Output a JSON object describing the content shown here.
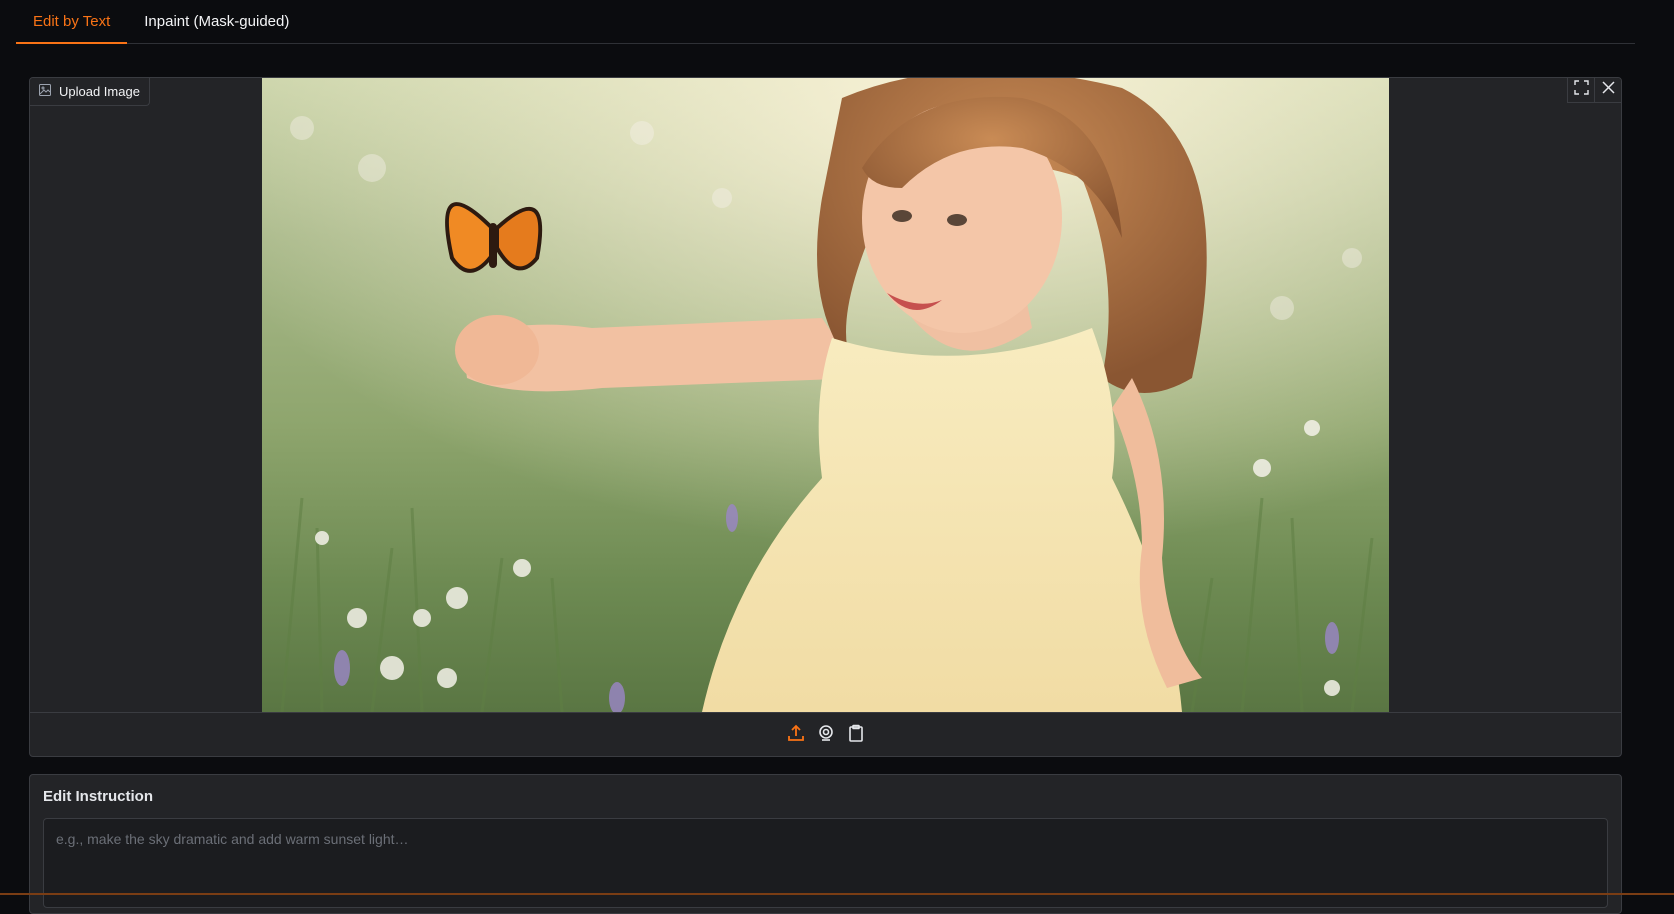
{
  "tabs": [
    {
      "label": "Edit by Text",
      "active": true
    },
    {
      "label": "Inpaint (Mask-guided)",
      "active": false
    }
  ],
  "image_component": {
    "label": "Upload Image",
    "label_icon": "image-icon",
    "top_controls": [
      "fullscreen-icon",
      "close-icon"
    ],
    "source_buttons": [
      "upload-icon",
      "webcam-icon",
      "clipboard-icon"
    ]
  },
  "instruction": {
    "label": "Edit Instruction",
    "placeholder": "e.g., make the sky dramatic and add warm sunset light…",
    "value": ""
  },
  "colors": {
    "accent": "#f97316",
    "background": "#0b0c0f",
    "panel": "#232427",
    "border": "#3a3c41"
  }
}
